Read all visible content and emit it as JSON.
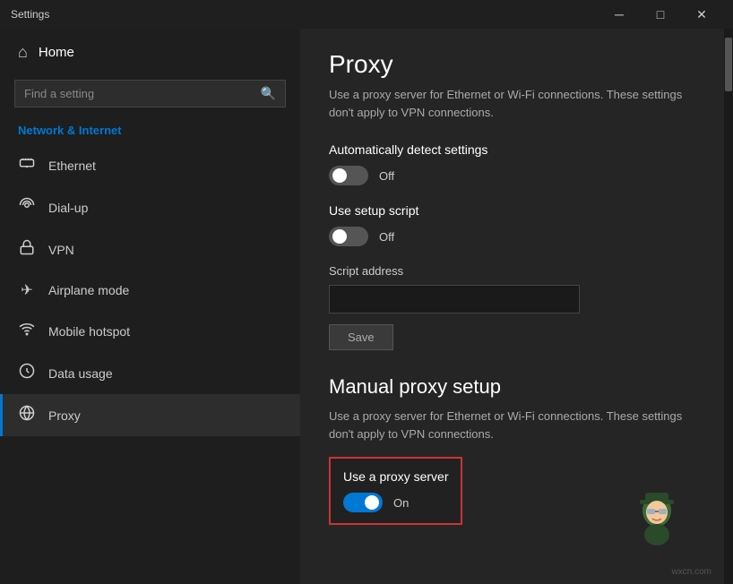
{
  "titleBar": {
    "title": "Settings",
    "minimize": "─",
    "maximize": "□",
    "close": "✕"
  },
  "sidebar": {
    "homeLabel": "Home",
    "searchPlaceholder": "Find a setting",
    "sectionLabel": "Network & Internet",
    "items": [
      {
        "id": "ethernet",
        "label": "Ethernet",
        "icon": "🖧"
      },
      {
        "id": "dialup",
        "label": "Dial-up",
        "icon": "📞"
      },
      {
        "id": "vpn",
        "label": "VPN",
        "icon": "🔒"
      },
      {
        "id": "airplane",
        "label": "Airplane mode",
        "icon": "✈"
      },
      {
        "id": "hotspot",
        "label": "Mobile hotspot",
        "icon": "📶"
      },
      {
        "id": "datausage",
        "label": "Data usage",
        "icon": "⊙"
      },
      {
        "id": "proxy",
        "label": "Proxy",
        "icon": "🌐"
      }
    ]
  },
  "content": {
    "pageTitle": "Proxy",
    "pageDescription": "Use a proxy server for Ethernet or Wi-Fi connections. These settings don't apply to VPN connections.",
    "autoDetectLabel": "Automatically detect settings",
    "autoDetectState": "Off",
    "setupScriptLabel": "Use setup script",
    "setupScriptState": "Off",
    "scriptAddressLabel": "Script address",
    "scriptAddressValue": "",
    "saveButton": "Save",
    "manualTitle": "Manual proxy setup",
    "manualDescription": "Use a proxy server for Ethernet or Wi-Fi connections. These settings don't apply to VPN connections.",
    "useProxyLabel": "Use a proxy server",
    "useProxyState": "On",
    "watermark": "wxcn.com"
  }
}
